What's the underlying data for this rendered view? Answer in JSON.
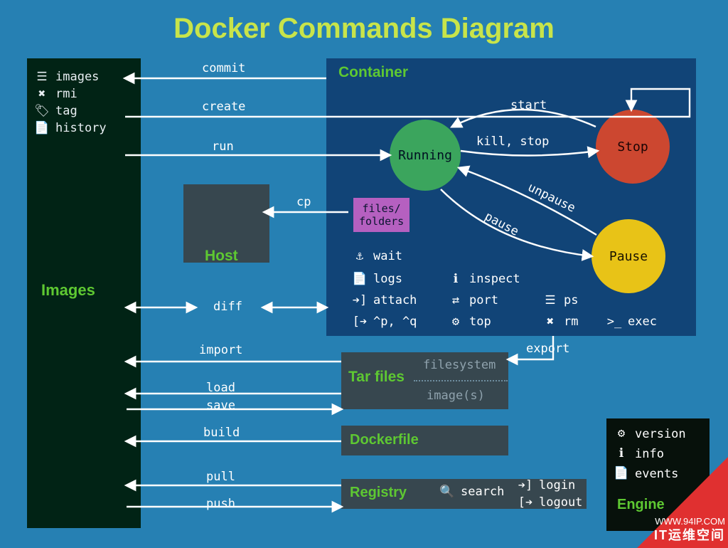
{
  "title": "Docker Commands Diagram",
  "images_panel": {
    "title": "Images",
    "items": [
      "images",
      "rmi",
      "tag",
      "history"
    ]
  },
  "container": {
    "title": "Container",
    "files_folders": "files/\nfolders",
    "states": {
      "running": "Running",
      "stop": "Stop",
      "pause": "Pause"
    },
    "transitions": {
      "start": "start",
      "kill_stop": "kill, stop",
      "unpause": "unpause",
      "pause": "pause"
    },
    "cmd_col1": [
      "wait",
      "logs",
      "attach",
      "^p, ^q"
    ],
    "cmd_col2": [
      "inspect",
      "port",
      "top"
    ],
    "cmd_col3": [
      "ps",
      "rm",
      "exec"
    ]
  },
  "host": {
    "title": "Host",
    "files_folders": "files/\nfolders"
  },
  "arrows": {
    "commit": "commit",
    "create": "create",
    "run": "run",
    "cp": "cp",
    "diff": "diff",
    "import": "import",
    "export": "export",
    "load": "load",
    "save": "save",
    "build": "build",
    "pull": "pull",
    "push": "push"
  },
  "tar": {
    "title": "Tar files",
    "filesystem": "filesystem",
    "images": "image(s)"
  },
  "dockerfile": {
    "title": "Dockerfile"
  },
  "registry": {
    "title": "Registry",
    "search": "search",
    "login": "login",
    "logout": "logout"
  },
  "engine": {
    "title": "Engine",
    "items": [
      "version",
      "info",
      "events"
    ]
  },
  "watermark": {
    "url": "WWW.94IP.COM",
    "brand": "IT运维空间"
  }
}
